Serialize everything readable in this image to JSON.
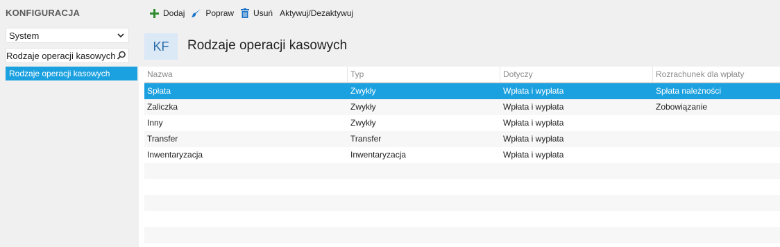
{
  "sidebar": {
    "title": "KONFIGURACJA",
    "select_value": "System",
    "search_value": "Rodzaje operacji kasowych",
    "items": [
      {
        "label": "Rodzaje operacji kasowych"
      }
    ]
  },
  "toolbar": {
    "add_label": "Dodaj",
    "edit_label": "Popraw",
    "delete_label": "Usuń",
    "toggle_label": "Aktywuj/Dezaktywuj"
  },
  "main": {
    "badge": "KF",
    "title": "Rodzaje operacji kasowych"
  },
  "table": {
    "columns": [
      "Nazwa",
      "Typ",
      "Dotyczy",
      "Rozrachunek dla wpłaty"
    ],
    "rows": [
      [
        "Spłata",
        "Zwykły",
        "Wpłata i wypłata",
        "Spłata należności"
      ],
      [
        "Zaliczka",
        "Zwykły",
        "Wpłata i wypłata",
        "Zobowiązanie"
      ],
      [
        "Inny",
        "Zwykły",
        "Wpłata i wypłata",
        ""
      ],
      [
        "Transfer",
        "Transfer",
        "Wpłata i wypłata",
        ""
      ],
      [
        "Inwentaryzacja",
        "Inwentaryzacja",
        "Wpłata i wypłata",
        ""
      ]
    ]
  },
  "colors": {
    "accent": "#1ca1e0",
    "add_icon": "#2e8b2e",
    "edit_icon": "#1a73c8",
    "delete_icon": "#1a73c8"
  }
}
